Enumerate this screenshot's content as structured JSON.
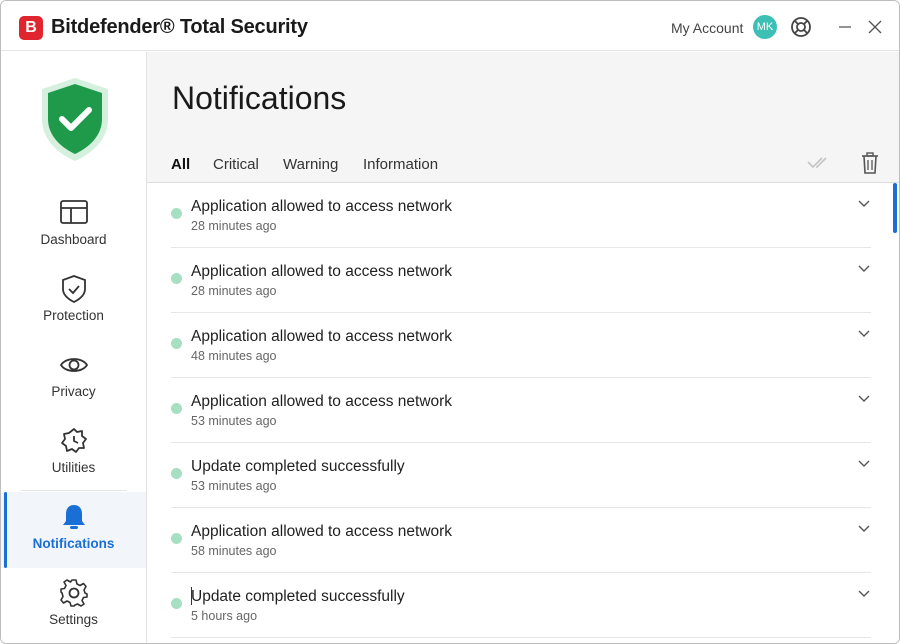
{
  "titlebar": {
    "logo_letter": "B",
    "app_title": "Bitdefender® Total Security",
    "account_label": "My Account",
    "avatar_initials": "MK"
  },
  "sidebar": {
    "items": [
      {
        "label": "Dashboard",
        "icon": "dashboard-icon"
      },
      {
        "label": "Protection",
        "icon": "shield-check-icon"
      },
      {
        "label": "Privacy",
        "icon": "eye-icon"
      },
      {
        "label": "Utilities",
        "icon": "utilities-icon"
      },
      {
        "label": "Notifications",
        "icon": "bell-icon",
        "active": true
      },
      {
        "label": "Settings",
        "icon": "gear-icon"
      }
    ]
  },
  "main": {
    "title": "Notifications",
    "tabs": [
      {
        "label": "All",
        "active": true
      },
      {
        "label": "Critical"
      },
      {
        "label": "Warning"
      },
      {
        "label": "Information"
      }
    ],
    "notifications": [
      {
        "title": "Application allowed to access network",
        "time": "28 minutes ago"
      },
      {
        "title": "Application allowed to access network",
        "time": "28 minutes ago"
      },
      {
        "title": "Application allowed to access network",
        "time": "48 minutes ago"
      },
      {
        "title": "Application allowed to access network",
        "time": "53 minutes ago"
      },
      {
        "title": "Update completed successfully",
        "time": "53 minutes ago"
      },
      {
        "title": "Application allowed to access network",
        "time": "58 minutes ago"
      },
      {
        "title": "Update completed successfully",
        "time": "5 hours ago"
      }
    ]
  },
  "colors": {
    "brand_red": "#e0252f",
    "accent_blue": "#1a6fd6",
    "shield_green": "#1e9a4a",
    "status_dot": "#a6dfc2",
    "avatar_teal": "#3cbfb5"
  }
}
